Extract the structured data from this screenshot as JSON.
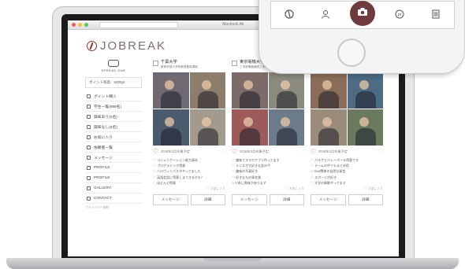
{
  "browser": {
    "window_title": "Macbook Air"
  },
  "app": {
    "logo_text": "JOBREAK"
  },
  "sidebar": {
    "company_name": "SPREAD ONE",
    "points_label": "ポイント残高：6000pt",
    "items": [
      {
        "label": "ポイント購入",
        "icon": "coin-icon"
      },
      {
        "label": "学生一覧(999名)",
        "icon": "search-icon"
      },
      {
        "label": "興味あり(0名)",
        "icon": "star-icon"
      },
      {
        "label": "興味なし(0名)",
        "icon": "star-icon"
      },
      {
        "label": "お気に入り",
        "icon": "heart-icon"
      },
      {
        "label": "依頼者一覧",
        "icon": "list-icon"
      },
      {
        "label": "メッセージ",
        "icon": "mail-icon"
      },
      {
        "label": "PROFILE",
        "icon": "user-icon"
      },
      {
        "label": "PROFILE",
        "icon": "user-icon"
      },
      {
        "label": "GALLERY",
        "icon": "image-icon"
      },
      {
        "label": "CONTACT",
        "icon": "phone-icon"
      }
    ],
    "footer": "プライバシー規約"
  },
  "cards": [
    {
      "university": "千葉大学",
      "faculty": "教育学部小学校教員養成課程",
      "date": "2016年3月卒業予定",
      "tags": [
        "コミュニケーション能力高め",
        "プログラミング得意",
        "ハロウィンパスタやってました",
        "英語会話に得意しまてきるかも？",
        "ほどんど得意"
      ],
      "footer": "♡ お気に入り",
      "buttons": [
        "メッセージ",
        "詳細"
      ]
    },
    {
      "university": "東京電機大学",
      "faculty": "工学部情報通信工学科卒業予定",
      "date": "2016年3月卒業予定",
      "tags": [
        "趣味でスマホアプリ作ってます",
        "テニスが大好きな女の子",
        "趣味の写真好き",
        "好きなもの東名鉄",
        "IT系に興味があります"
      ],
      "footer": "♡ お気に入り",
      "buttons": [
        "メッセージ",
        "詳細"
      ]
    },
    {
      "university": "",
      "faculty": "",
      "date": "2016年3月卒業予定",
      "tags": [
        "バスケとバレーボール得意です",
        "チームの中でもまとめ役",
        "SNS関係の自然な発信",
        "スポーツが好き",
        "大学の新歓やってます"
      ],
      "footer": "♡ お気に入り",
      "buttons": [
        "メッセージ",
        "詳細"
      ]
    }
  ],
  "phone": {
    "tabs": [
      "logo-icon",
      "person-icon",
      "camera-icon",
      "points-icon",
      "document-icon"
    ],
    "active_tab": "camera-icon"
  },
  "colors": {
    "brand": "#6e3b3e",
    "accent": "#c4475a"
  }
}
